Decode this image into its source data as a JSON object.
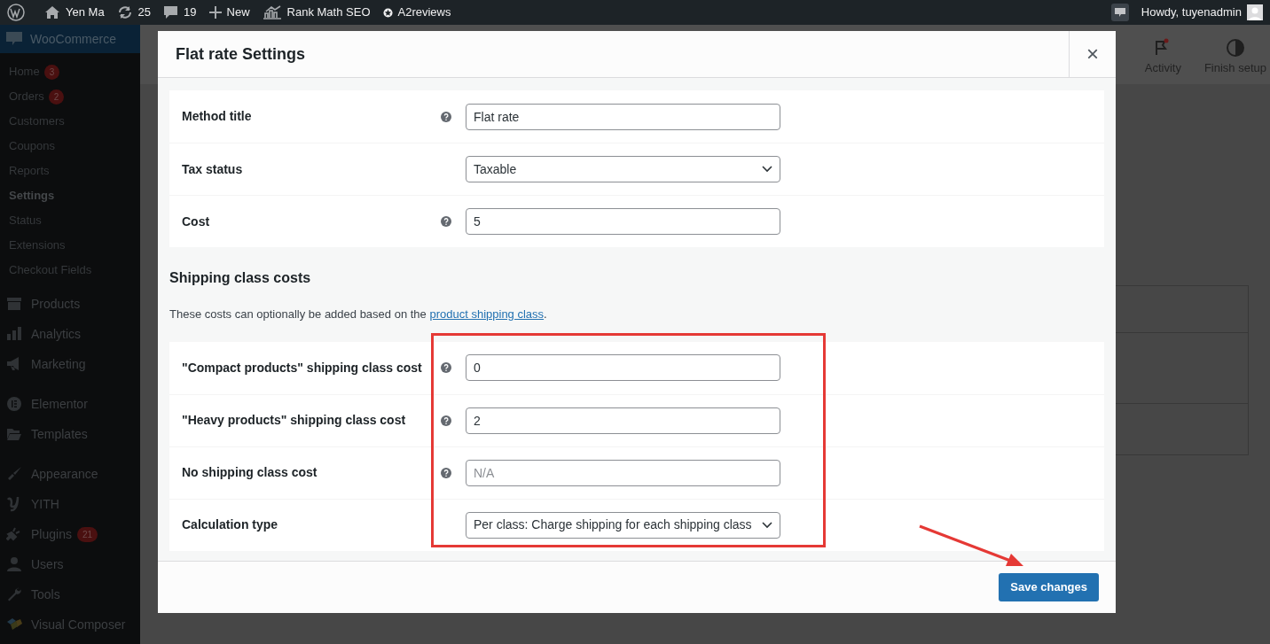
{
  "admin_bar": {
    "site": "Yen Ma",
    "updates": "25",
    "comments": "19",
    "new": "New",
    "seo": "Rank Math SEO",
    "reviews": "A2reviews",
    "greeting": "Howdy, tuyenadmin"
  },
  "sidebar": {
    "menu_title": "WooCommerce",
    "submenu": [
      {
        "label": "Home",
        "badge": "3",
        "selected": false
      },
      {
        "label": "Orders",
        "badge": "2",
        "selected": false
      },
      {
        "label": "Customers",
        "selected": false
      },
      {
        "label": "Coupons",
        "selected": false
      },
      {
        "label": "Reports",
        "selected": false
      },
      {
        "label": "Settings",
        "selected": true
      },
      {
        "label": "Status",
        "selected": false
      },
      {
        "label": "Extensions",
        "selected": false
      },
      {
        "label": "Checkout Fields",
        "selected": false
      }
    ],
    "groups": [
      [
        {
          "label": "Products"
        },
        {
          "label": "Analytics"
        },
        {
          "label": "Marketing"
        }
      ],
      [
        {
          "label": "Elementor"
        },
        {
          "label": "Templates"
        }
      ],
      [
        {
          "label": "Appearance"
        },
        {
          "label": "YITH"
        },
        {
          "label": "Plugins",
          "badge": "21"
        },
        {
          "label": "Users"
        },
        {
          "label": "Tools"
        },
        {
          "label": "Visual Composer"
        }
      ]
    ]
  },
  "header_actions": [
    {
      "label": "Activity"
    },
    {
      "label": "Finish setup"
    }
  ],
  "modal": {
    "title": "Flat rate Settings",
    "close": "×",
    "fields": [
      {
        "label": "Method title",
        "kind": "input",
        "help": true,
        "value": "Flat rate"
      },
      {
        "label": "Tax status",
        "kind": "select",
        "help": false,
        "value": "Taxable"
      },
      {
        "label": "Cost",
        "kind": "input",
        "help": true,
        "value": "5"
      }
    ],
    "section_title": "Shipping class costs",
    "section_text": "These costs can optionally be added based on the ",
    "section_link": "product shipping class",
    "section_end": ".",
    "class_fields": [
      {
        "label": "\"Compact products\" shipping class cost",
        "kind": "input",
        "help": true,
        "value": "0"
      },
      {
        "label": "\"Heavy products\" shipping class cost",
        "kind": "input",
        "help": true,
        "value": "2"
      },
      {
        "label": "No shipping class cost",
        "kind": "input",
        "help": true,
        "placeholder": "N/A"
      },
      {
        "label": "Calculation type",
        "kind": "select",
        "help": false,
        "value": "Per class: Charge shipping for each shipping class"
      }
    ],
    "save": "Save changes"
  },
  "annotations": {
    "highlight_box": true,
    "arrow": true
  }
}
